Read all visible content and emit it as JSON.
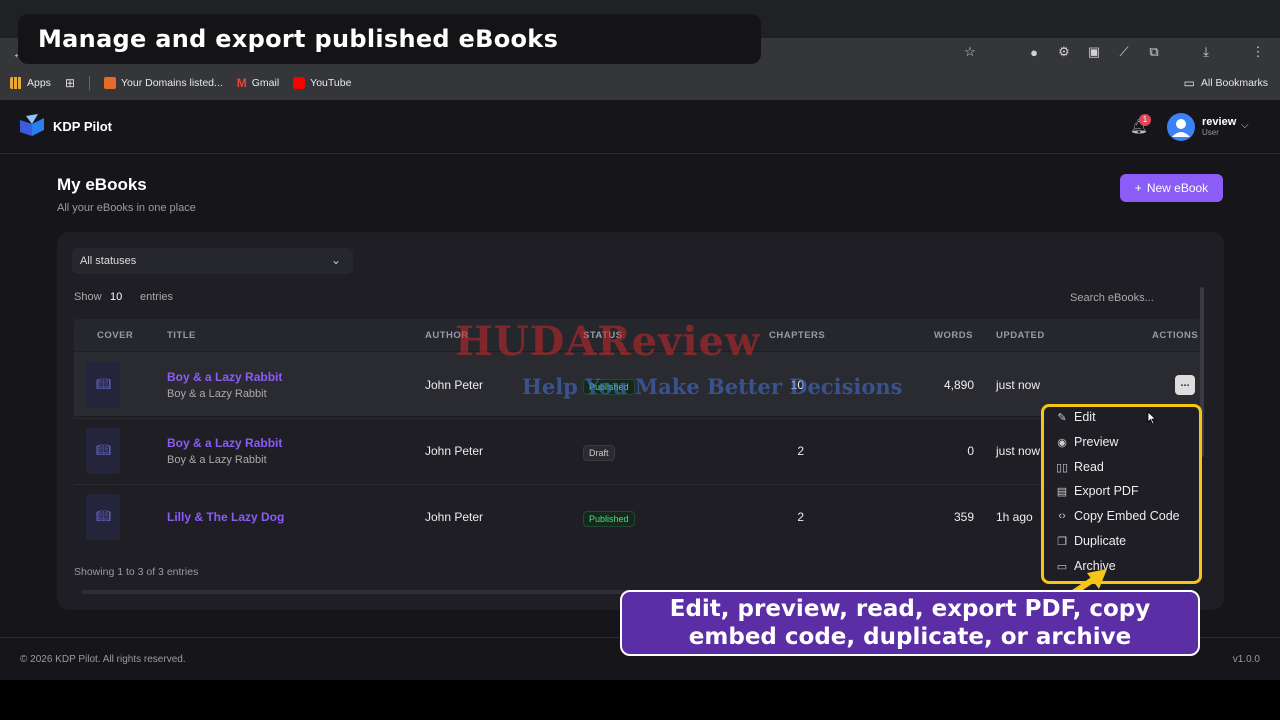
{
  "caption_top": "Manage and export published eBooks",
  "bookmarks": {
    "items": [
      "Apps",
      "Your Domains listed...",
      "Gmail",
      "YouTube"
    ],
    "all": "All Bookmarks"
  },
  "app": {
    "name": "KDP Pilot",
    "notifications": "1",
    "user_name": "review",
    "user_role": "User"
  },
  "page": {
    "title": "My eBooks",
    "subtitle": "All your eBooks in one place",
    "new_button": "New eBook"
  },
  "filters": {
    "status": "All statuses",
    "show_label": "Show",
    "show_value": "10",
    "entries_label": "entries",
    "search_placeholder": "Search eBooks..."
  },
  "table": {
    "headers": [
      "COVER",
      "TITLE",
      "AUTHOR",
      "STATUS",
      "CHAPTERS",
      "WORDS",
      "UPDATED",
      "ACTIONS"
    ],
    "rows": [
      {
        "title": "Boy & a Lazy Rabbit",
        "subtitle": "Boy & a Lazy Rabbit",
        "author": "John Peter",
        "status": "Published",
        "chapters": "10",
        "words": "4,890",
        "updated": "just now"
      },
      {
        "title": "Boy & a Lazy Rabbit",
        "subtitle": "Boy & a Lazy Rabbit",
        "author": "John Peter",
        "status": "Draft",
        "chapters": "2",
        "words": "0",
        "updated": "just now"
      },
      {
        "title": "Lilly & The Lazy Dog",
        "subtitle": "",
        "author": "John Peter",
        "status": "Published",
        "chapters": "2",
        "words": "359",
        "updated": "1h ago"
      }
    ],
    "showing": "Showing 1 to 3 of 3 entries",
    "action_label": "..."
  },
  "menu": {
    "items": [
      {
        "label": "Edit",
        "icon": "pencil-icon"
      },
      {
        "label": "Preview",
        "icon": "eye-icon"
      },
      {
        "label": "Read",
        "icon": "book-icon"
      },
      {
        "label": "Export PDF",
        "icon": "pdf-icon"
      },
      {
        "label": "Copy Embed Code",
        "icon": "code-icon"
      },
      {
        "label": "Duplicate",
        "icon": "copy-icon"
      },
      {
        "label": "Archive",
        "icon": "archive-icon"
      }
    ]
  },
  "footer": {
    "copyright": "© 2026 KDP Pilot. All rights reserved.",
    "version": "v1.0.0"
  },
  "callout": {
    "line1": "Edit, preview, read, export PDF, copy",
    "line2": "embed code, duplicate, or archive"
  },
  "watermark": {
    "line1": "HUDAReview",
    "line2": "Help You Make Better Decisions"
  },
  "colors": {
    "accent": "#8b5cf6",
    "highlight": "#f5c518",
    "callout_bg": "#5b2ea6",
    "published": "#4ade80"
  }
}
